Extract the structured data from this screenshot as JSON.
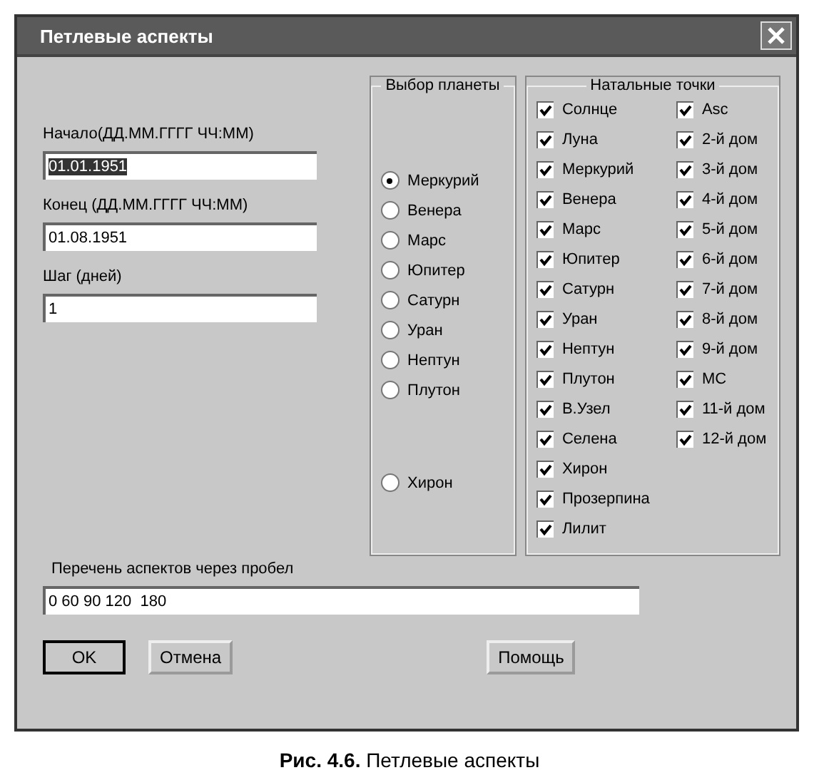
{
  "window": {
    "title": "Петлевые аспекты"
  },
  "fields": [
    {
      "label": "Начало(ДД.ММ.ГГГГ ЧЧ:ММ)",
      "value": "01.01.1951",
      "text_selected": true
    },
    {
      "label": "Конец (ДД.ММ.ГГГГ ЧЧ:ММ)",
      "value": "01.08.1951",
      "text_selected": false
    },
    {
      "label": "Шаг (дней)",
      "value": "1",
      "text_selected": false
    }
  ],
  "planet_group": {
    "title": "Выбор планеты",
    "options": [
      {
        "label": "Меркурий",
        "selected": true
      },
      {
        "label": "Венера",
        "selected": false
      },
      {
        "label": "Марс",
        "selected": false
      },
      {
        "label": "Юпитер",
        "selected": false
      },
      {
        "label": "Сатурн",
        "selected": false
      },
      {
        "label": "Уран",
        "selected": false
      },
      {
        "label": "Нептун",
        "selected": false
      },
      {
        "label": "Плутон",
        "selected": false
      },
      {
        "label": "Хирон",
        "selected": false
      }
    ]
  },
  "natal_group": {
    "title": "Натальные точки",
    "column_1": [
      {
        "label": "Солнце",
        "checked": true
      },
      {
        "label": "Луна",
        "checked": true
      },
      {
        "label": "Меркурий",
        "checked": true
      },
      {
        "label": "Венера",
        "checked": true
      },
      {
        "label": "Марс",
        "checked": true
      },
      {
        "label": "Юпитер",
        "checked": true
      },
      {
        "label": "Сатурн",
        "checked": true
      },
      {
        "label": "Уран",
        "checked": true
      },
      {
        "label": "Нептун",
        "checked": true
      },
      {
        "label": "Плутон",
        "checked": true
      },
      {
        "label": "В.Узел",
        "checked": true
      },
      {
        "label": "Селена",
        "checked": true
      },
      {
        "label": "Хирон",
        "checked": true
      },
      {
        "label": "Прозерпина",
        "checked": true
      },
      {
        "label": "Лилит",
        "checked": true
      }
    ],
    "column_2": [
      {
        "label": "Asc",
        "checked": true
      },
      {
        "label": "2-й дом",
        "checked": true
      },
      {
        "label": "3-й дом",
        "checked": true
      },
      {
        "label": "4-й дом",
        "checked": true
      },
      {
        "label": "5-й дом",
        "checked": true
      },
      {
        "label": "6-й дом",
        "checked": true
      },
      {
        "label": "7-й дом",
        "checked": true
      },
      {
        "label": "8-й дом",
        "checked": true
      },
      {
        "label": "9-й дом",
        "checked": true
      },
      {
        "label": "MC",
        "checked": true
      },
      {
        "label": "11-й дом",
        "checked": true
      },
      {
        "label": "12-й дом",
        "checked": true
      }
    ]
  },
  "aspects": {
    "label": "Перечень аспектов через пробел",
    "value": "0 60 90 120  180"
  },
  "buttons": [
    {
      "label": "OK",
      "default": true
    },
    {
      "label": "Отмена",
      "default": false
    },
    {
      "label": "Помощь",
      "default": false
    }
  ],
  "caption": "**Рис. 4.6.** Петлевые аспекты"
}
